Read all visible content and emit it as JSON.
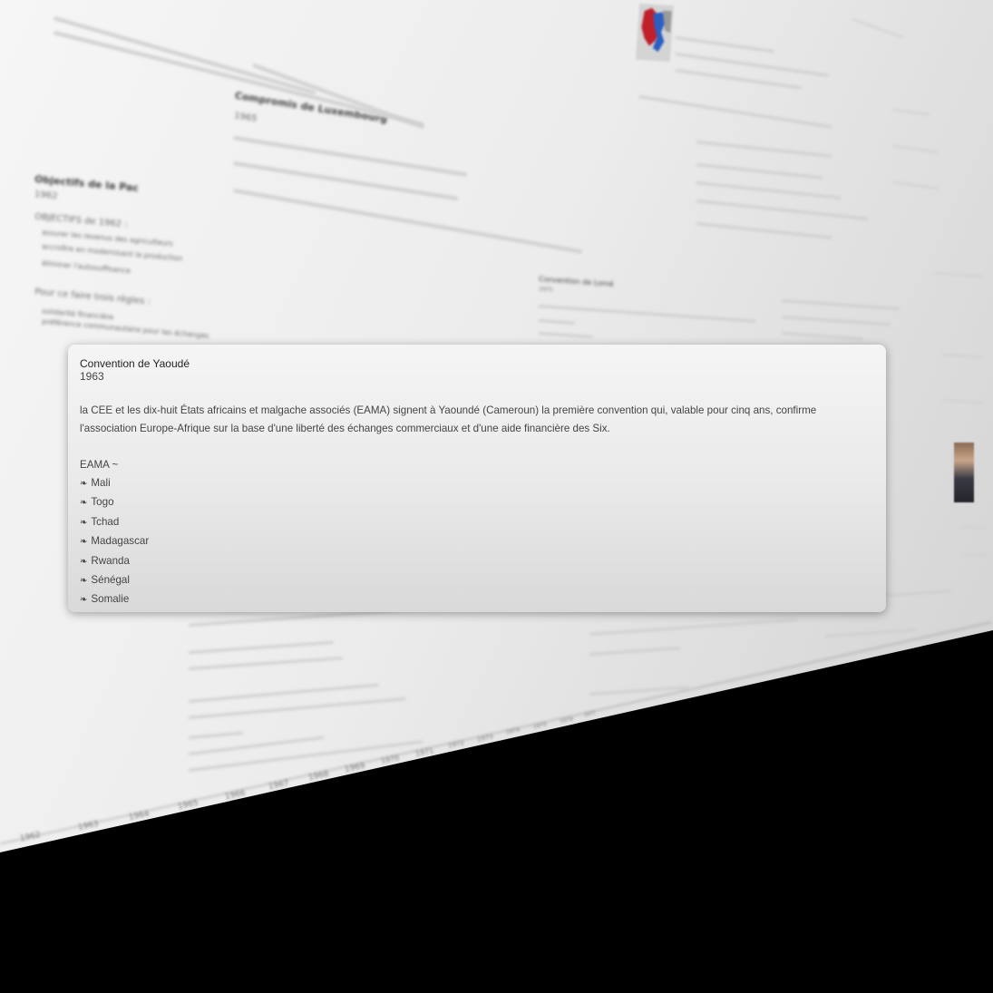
{
  "card": {
    "title": "Convention de Yaoudé",
    "year": "1963",
    "body": "la CEE et les dix-huit États africains et malgache associés (EAMA) signent à Yaoundé (Cameroun) la première convention qui, valable pour cinq ans, confirme l'association Europe-Afrique sur la base d'une liberté des échanges commerciaux et d'une aide financière des Six.",
    "eama_label": "EAMA ~",
    "bullet_glyph": "❧",
    "countries": [
      "Mali",
      "Togo",
      "Tchad",
      "Madagascar",
      "Rwanda",
      "Sénégal",
      "Somalie"
    ]
  },
  "background": {
    "items": [
      {
        "title": "Objectifs de la Pac",
        "year": "1962"
      },
      {
        "title": "Compromis de Luxembourg",
        "year": "1965"
      },
      {
        "title": "Convention de Lomé",
        "year": "1975"
      }
    ],
    "objectives_heading": "OBJECTIFS de 1962 :",
    "objectives": [
      "assurer les revenus des agriculteurs",
      "accroître en modernisant la production",
      "éliminer l'autosuffisance"
    ],
    "rules_heading": "Pour ce faire trois règles :",
    "rules": [
      "solidarité financière",
      "préférence communautaire pour les échanges"
    ],
    "ticks": [
      "1962",
      "1963",
      "1964",
      "1965",
      "1966",
      "1967",
      "1968",
      "1969",
      "1970",
      "1971",
      "1972",
      "1973",
      "1974",
      "1975",
      "1976",
      "1977"
    ]
  },
  "colors": {
    "map_red": "#c0202a",
    "map_blue": "#2a5fc4"
  }
}
